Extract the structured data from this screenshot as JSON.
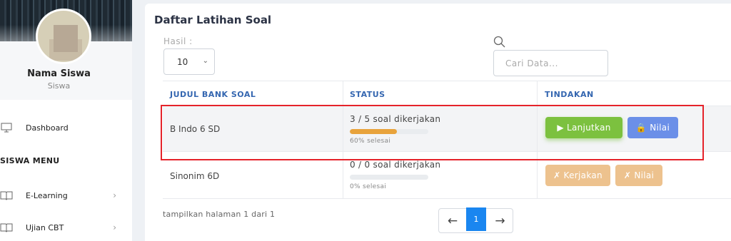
{
  "sidebar": {
    "profile": {
      "name": "Nama Siswa",
      "role": "Siswa"
    },
    "items": [
      {
        "label": "Dashboard",
        "icon": "monitor-icon"
      },
      {
        "label": "E-Learning",
        "icon": "book-icon",
        "chevron": "›"
      },
      {
        "label": "Ujian CBT",
        "icon": "book-icon",
        "chevron": "›"
      }
    ],
    "section_title": "SISWA MENU"
  },
  "main": {
    "title": "Daftar Latihan Soal",
    "hasil_label": "Hasil :",
    "page_size": "10",
    "search": {
      "placeholder": "Cari Data..."
    },
    "table": {
      "headers": [
        "JUDUL BANK SOAL",
        "STATUS",
        "TINDAKAN"
      ],
      "rows": [
        {
          "title": "B Indo 6 SD",
          "status": "3 / 5 soal dikerjakan",
          "progress_percent": 60,
          "progress_label": "60% selesai",
          "actions": [
            {
              "label": "▶ Lanjutkan",
              "style": "green"
            },
            {
              "label": "🔒 Nilai",
              "style": "blue"
            }
          ]
        },
        {
          "title": "Sinonim 6D",
          "status": "0 / 0 soal dikerjakan",
          "progress_percent": 0,
          "progress_label": "0% selesai",
          "actions": [
            {
              "label": "✗ Kerjakan",
              "style": "peach"
            },
            {
              "label": "✗ Nilai",
              "style": "peach"
            }
          ]
        }
      ]
    },
    "footer": {
      "page_info": "tampilkan halaman 1 dari 1",
      "current_page": "1",
      "prev": "←",
      "next": "→"
    }
  },
  "colors": {
    "accent_blue": "#3466b0",
    "progress": "#e8a33c",
    "green_button": "#7cc13f",
    "blue_button": "#6b8fe8",
    "peach_button": "#edc28e",
    "highlight": "#e5232a",
    "pager_active": "#1a86f0"
  }
}
